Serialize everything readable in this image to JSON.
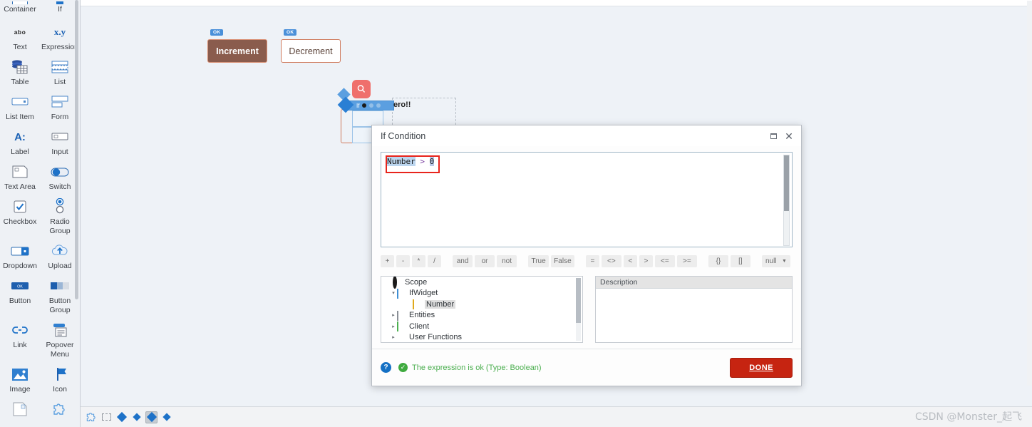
{
  "palette": {
    "items": [
      {
        "label": "Container",
        "icon": "container-icon",
        "cut_top": true
      },
      {
        "label": "If",
        "icon": "if-icon",
        "cut_top": true
      },
      {
        "label": "Text",
        "icon": "abo-text-icon"
      },
      {
        "label": "Expression",
        "icon": "xy-expression-icon"
      },
      {
        "label": "Table",
        "icon": "table-icon"
      },
      {
        "label": "List",
        "icon": "list-icon"
      },
      {
        "label": "List Item",
        "icon": "list-item-icon"
      },
      {
        "label": "Form",
        "icon": "form-icon"
      },
      {
        "label": "Label",
        "icon": "label-icon"
      },
      {
        "label": "Input",
        "icon": "input-icon"
      },
      {
        "label": "Text Area",
        "icon": "text-area-icon"
      },
      {
        "label": "Switch",
        "icon": "switch-icon"
      },
      {
        "label": "Checkbox",
        "icon": "checkbox-icon"
      },
      {
        "label": "Radio Group",
        "icon": "radio-group-icon"
      },
      {
        "label": "Dropdown",
        "icon": "dropdown-icon"
      },
      {
        "label": "Upload",
        "icon": "upload-icon"
      },
      {
        "label": "Button",
        "icon": "button-icon"
      },
      {
        "label": "Button Group",
        "icon": "button-group-icon"
      },
      {
        "label": "Link",
        "icon": "link-icon"
      },
      {
        "label": "Popover Menu",
        "icon": "popover-menu-icon"
      },
      {
        "label": "Image",
        "icon": "image-icon"
      },
      {
        "label": "Icon",
        "icon": "icon-icon"
      },
      {
        "label": "",
        "icon": "placeholder-box-icon"
      },
      {
        "label": "",
        "icon": "puzzle-icon"
      }
    ]
  },
  "canvas": {
    "increment_button": {
      "label": "Increment",
      "badge": "OK"
    },
    "decrement_button": {
      "label": "Decrement",
      "badge": "OK"
    },
    "if_widget": {
      "label": "If",
      "search_icon": "magnifier-icon",
      "trailing_text": "ero!!"
    }
  },
  "dialog": {
    "title": "If Condition",
    "maximize_icon": "maximize-icon",
    "close_icon": "close-icon",
    "expression": {
      "selected_token": "Number",
      "operator": " > ",
      "value": "0",
      "full_text": "Number > 0"
    },
    "operators": {
      "arithmetic": [
        "+",
        "-",
        "*",
        "/"
      ],
      "logical": [
        "and",
        "or",
        "not"
      ],
      "booleans": [
        "True",
        "False"
      ],
      "comparison": [
        "=",
        "<>",
        "<",
        ">",
        "<=",
        ">="
      ],
      "brackets": [
        "{}",
        "[]"
      ],
      "null_label": "null",
      "null_caret": "caret-down-icon"
    },
    "scope_tree": [
      {
        "label": "Scope",
        "icon": "scope-icon",
        "indent": 0,
        "arrow": "",
        "selected": false
      },
      {
        "label": "IfWidget",
        "icon": "blue-square-icon",
        "indent": 1,
        "arrow": "▾",
        "selected": false
      },
      {
        "label": "Number",
        "icon": "yellow-square-icon",
        "indent": 2,
        "arrow": "",
        "selected": true
      },
      {
        "label": "Entities",
        "icon": "entities-icon",
        "indent": 1,
        "arrow": "▸",
        "selected": false
      },
      {
        "label": "Client",
        "icon": "green-square-icon",
        "indent": 1,
        "arrow": "▸",
        "selected": false
      },
      {
        "label": "User Functions",
        "icon": "folder-icon",
        "indent": 1,
        "arrow": "▸",
        "selected": false
      }
    ],
    "description": {
      "header": "Description",
      "value": ""
    },
    "footer": {
      "help_icon": "question-mark-icon",
      "status_icon": "check-circle-icon",
      "status_text": "The expression is ok (Type: Boolean)",
      "done_label": "DONE"
    }
  },
  "bottombar": {
    "items": [
      {
        "icon": "puzzle-icon",
        "active": false
      },
      {
        "icon": "dashed-rect-icon",
        "active": false
      },
      {
        "icon": "diamond-icon",
        "active": false
      },
      {
        "icon": "diamond-small-icon",
        "active": false
      },
      {
        "icon": "diamond-icon",
        "active": true
      },
      {
        "icon": "diamond-small-icon",
        "active": false
      }
    ],
    "watermark": "CSDN @Monster_起飞"
  },
  "colors": {
    "accent_blue": "#1e72c8",
    "done_red": "#c62411",
    "ok_green": "#4caf50",
    "canvas_bg": "#eef2f7",
    "node_brown": "#8a5c4d"
  }
}
